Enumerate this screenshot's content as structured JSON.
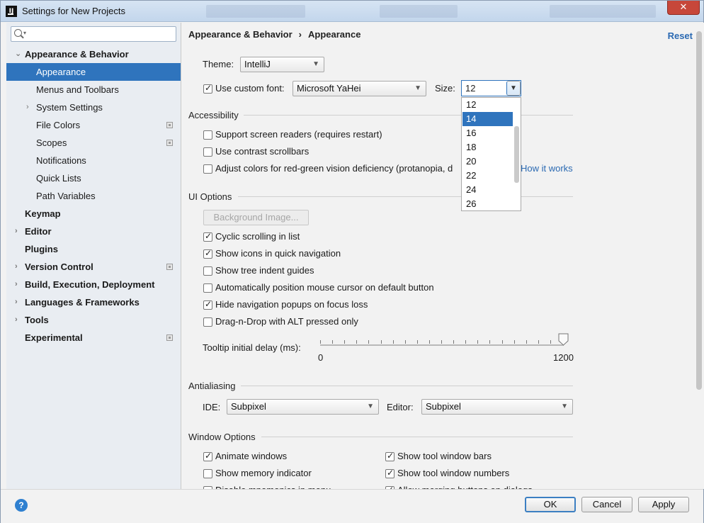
{
  "window": {
    "title": "Settings for New Projects",
    "close_glyph": "✕",
    "app_icon_text": "IJ"
  },
  "sidebar": {
    "search": {
      "placeholder": "",
      "dropdown_glyph": "▾"
    },
    "items": [
      {
        "label": "Appearance & Behavior",
        "bold": true,
        "arrow": "⌄",
        "level": 0
      },
      {
        "label": "Appearance",
        "selected": true,
        "level": 1
      },
      {
        "label": "Menus and Toolbars",
        "level": 1
      },
      {
        "label": "System Settings",
        "arrow": "›",
        "level": 1
      },
      {
        "label": "File Colors",
        "level": 1,
        "project_icon": true
      },
      {
        "label": "Scopes",
        "level": 1,
        "project_icon": true
      },
      {
        "label": "Notifications",
        "level": 1
      },
      {
        "label": "Quick Lists",
        "level": 1
      },
      {
        "label": "Path Variables",
        "level": 1
      },
      {
        "label": "Keymap",
        "bold": true,
        "level": 0
      },
      {
        "label": "Editor",
        "bold": true,
        "arrow": "›",
        "level": 0
      },
      {
        "label": "Plugins",
        "bold": true,
        "level": 0
      },
      {
        "label": "Version Control",
        "bold": true,
        "arrow": "›",
        "level": 0,
        "project_icon": true
      },
      {
        "label": "Build, Execution, Deployment",
        "bold": true,
        "arrow": "›",
        "level": 0
      },
      {
        "label": "Languages & Frameworks",
        "bold": true,
        "arrow": "›",
        "level": 0
      },
      {
        "label": "Tools",
        "bold": true,
        "arrow": "›",
        "level": 0
      },
      {
        "label": "Experimental",
        "bold": true,
        "level": 0,
        "project_icon": true
      }
    ]
  },
  "main": {
    "breadcrumb": {
      "parent": "Appearance & Behavior",
      "separator": "›",
      "current": "Appearance"
    },
    "reset_label": "Reset",
    "theme": {
      "label": "Theme:",
      "value": "IntelliJ"
    },
    "custom_font": {
      "label": "Use custom font:",
      "checked": true,
      "font_value": "Microsoft YaHei",
      "size_label": "Size:",
      "size_value": "12"
    },
    "size_options": [
      "12",
      "14",
      "16",
      "18",
      "20",
      "22",
      "24",
      "26"
    ],
    "size_highlighted": "14",
    "accessibility": {
      "title": "Accessibility",
      "items": [
        {
          "label": "Support screen readers (requires restart)",
          "checked": false
        },
        {
          "label": "Use contrast scrollbars",
          "checked": false
        },
        {
          "label": "Adjust colors for red-green vision deficiency (protanopia, d",
          "checked": false,
          "link": "How it works"
        }
      ]
    },
    "ui_options": {
      "title": "UI Options",
      "background_button": "Background Image...",
      "items": [
        {
          "label": "Cyclic scrolling in list",
          "checked": true
        },
        {
          "label": "Show icons in quick navigation",
          "checked": true
        },
        {
          "label": "Show tree indent guides",
          "checked": false
        },
        {
          "label": "Automatically position mouse cursor on default button",
          "checked": false
        },
        {
          "label": "Hide navigation popups on focus loss",
          "checked": true
        },
        {
          "label": "Drag-n-Drop with ALT pressed only",
          "checked": false
        }
      ],
      "tooltip": {
        "label": "Tooltip initial delay (ms):",
        "min": "0",
        "max": "1200",
        "value": 1200
      }
    },
    "antialiasing": {
      "title": "Antialiasing",
      "ide_label": "IDE:",
      "ide_value": "Subpixel",
      "editor_label": "Editor:",
      "editor_value": "Subpixel"
    },
    "window_options": {
      "title": "Window Options",
      "left": [
        {
          "label": "Animate windows",
          "checked": true
        },
        {
          "label": "Show memory indicator",
          "checked": false
        },
        {
          "label": "Disable mnemonics in menu",
          "checked": false
        }
      ],
      "right": [
        {
          "label": "Show tool window bars",
          "checked": true
        },
        {
          "label": "Show tool window numbers",
          "checked": true
        },
        {
          "label": "Allow merging buttons on dialogs",
          "checked": true
        }
      ]
    }
  },
  "footer": {
    "help": "?",
    "ok": "OK",
    "cancel": "Cancel",
    "apply": "Apply"
  },
  "colors": {
    "selection": "#2f74bd",
    "link": "#2a69b2",
    "close": "#c7473a"
  }
}
